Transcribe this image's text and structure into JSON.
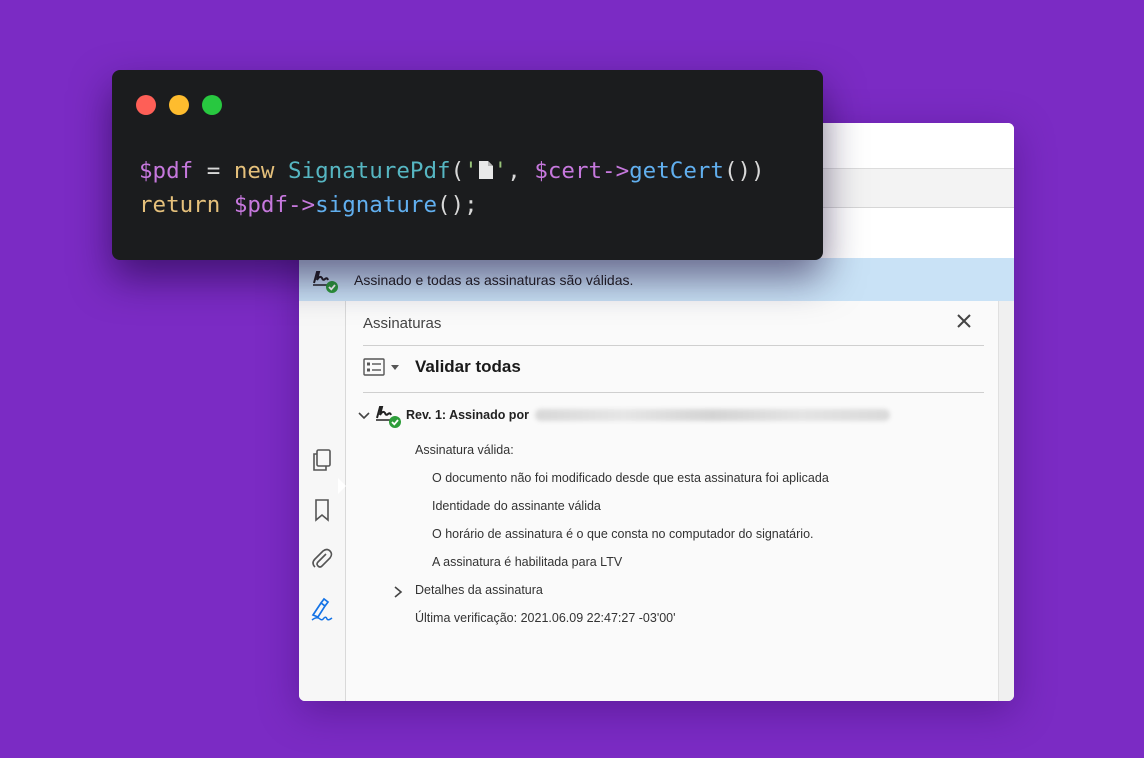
{
  "code_window": {
    "dots": [
      {
        "name": "close",
        "color": "#fe5f57"
      },
      {
        "name": "minimize",
        "color": "#febc2e"
      },
      {
        "name": "zoom",
        "color": "#28c840"
      }
    ],
    "line1": {
      "var1": "$pdf",
      "eq": " = ",
      "new_kw": "new",
      "class_name": "SignaturePdf",
      "paren_open": "(",
      "quote_open": "'",
      "quote_close": "'",
      "comma": ", ",
      "var2": "$cert",
      "arrow": "->",
      "method": "getCert",
      "tail": "())"
    },
    "line2": {
      "return_kw": "return",
      "var": "$pdf",
      "arrow": "->",
      "method": "signature",
      "tail": "();"
    }
  },
  "viewer": {
    "status_banner": "Assinado e todas as assinaturas são válidas.",
    "panel_title": "Assinaturas",
    "validate_all": "Validar todas",
    "revision_label": "Rev. 1: Assinado por",
    "details": {
      "heading": "Assinatura válida:",
      "items": [
        "O documento não foi modificado desde que esta assinatura foi aplicada",
        "Identidade do assinante válida",
        "O horário de assinatura é o que consta no computador do signatário.",
        "A assinatura é habilitada para LTV"
      ],
      "signature_details": "Detalhes da assinatura",
      "last_check": "Última verificação: 2021.06.09 22:47:27 -03'00'"
    },
    "colors": {
      "banner": "#c9e2f6",
      "accent": "#1473e6",
      "valid": "#2d9d3a"
    }
  }
}
